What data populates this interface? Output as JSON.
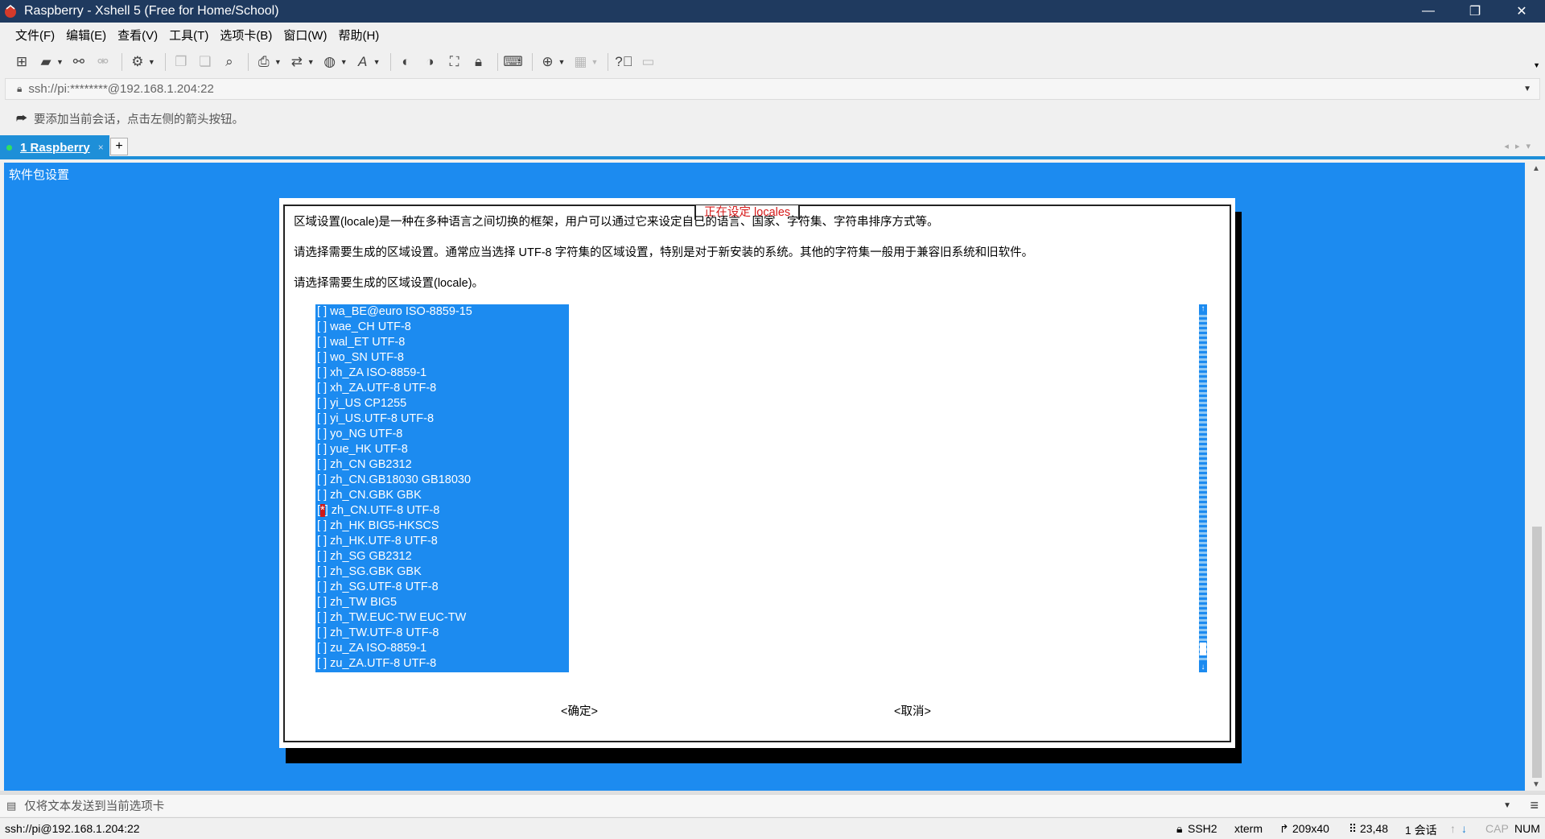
{
  "window": {
    "title": "Raspberry - Xshell 5 (Free for Home/School)"
  },
  "menu": [
    "文件(F)",
    "编辑(E)",
    "查看(V)",
    "工具(T)",
    "选项卡(B)",
    "窗口(W)",
    "帮助(H)"
  ],
  "address": {
    "value": "ssh://pi:********@192.168.1.204:22"
  },
  "hint": {
    "text": "要添加当前会话，点击左侧的箭头按钮。"
  },
  "tab": {
    "label": "1 Raspberry",
    "close": "×",
    "add": "+"
  },
  "terminal": {
    "title": "软件包设置",
    "dialog": {
      "title": "正在设定 locales",
      "desc1": "区域设置(locale)是一种在多种语言之间切换的框架，用户可以通过它来设定自己的语言、国家、字符集、字符串排序方式等。",
      "desc2": "请选择需要生成的区域设置。通常应当选择 UTF-8 字符集的区域设置，特别是对于新安装的系统。其他的字符集一般用于兼容旧系统和旧软件。",
      "desc3": "请选择需要生成的区域设置(locale)。",
      "items": [
        {
          "mark": " ",
          "name": "wa_BE@euro ISO-8859-15"
        },
        {
          "mark": " ",
          "name": "wae_CH UTF-8"
        },
        {
          "mark": " ",
          "name": "wal_ET UTF-8"
        },
        {
          "mark": " ",
          "name": "wo_SN UTF-8"
        },
        {
          "mark": " ",
          "name": "xh_ZA ISO-8859-1"
        },
        {
          "mark": " ",
          "name": "xh_ZA.UTF-8 UTF-8"
        },
        {
          "mark": " ",
          "name": "yi_US CP1255"
        },
        {
          "mark": " ",
          "name": "yi_US.UTF-8 UTF-8"
        },
        {
          "mark": " ",
          "name": "yo_NG UTF-8"
        },
        {
          "mark": " ",
          "name": "yue_HK UTF-8"
        },
        {
          "mark": " ",
          "name": "zh_CN GB2312"
        },
        {
          "mark": " ",
          "name": "zh_CN.GB18030 GB18030"
        },
        {
          "mark": " ",
          "name": "zh_CN.GBK GBK"
        },
        {
          "mark": "*",
          "name": "zh_CN.UTF-8 UTF-8"
        },
        {
          "mark": " ",
          "name": "zh_HK BIG5-HKSCS"
        },
        {
          "mark": " ",
          "name": "zh_HK.UTF-8 UTF-8"
        },
        {
          "mark": " ",
          "name": "zh_SG GB2312"
        },
        {
          "mark": " ",
          "name": "zh_SG.GBK GBK"
        },
        {
          "mark": " ",
          "name": "zh_SG.UTF-8 UTF-8"
        },
        {
          "mark": " ",
          "name": "zh_TW BIG5"
        },
        {
          "mark": " ",
          "name": "zh_TW.EUC-TW EUC-TW"
        },
        {
          "mark": " ",
          "name": "zh_TW.UTF-8 UTF-8"
        },
        {
          "mark": " ",
          "name": "zu_ZA ISO-8859-1"
        },
        {
          "mark": " ",
          "name": "zu_ZA.UTF-8 UTF-8"
        }
      ],
      "ok": "<确定>",
      "cancel": "<取消>"
    }
  },
  "sendbar": {
    "text": "仅将文本发送到当前选项卡"
  },
  "status": {
    "connection": "ssh://pi@192.168.1.204:22",
    "protocol": "SSH2",
    "term": "xterm",
    "size": "209x40",
    "cursor": "23,48",
    "sessions": "1 会话",
    "caps": "CAP",
    "num": "NUM"
  },
  "colors": {
    "terminal_bg": "#1c8bf0",
    "title_bg": "#1f3a5f",
    "dialog_title": "#d61a1a",
    "selected_mark": "#d01818"
  }
}
